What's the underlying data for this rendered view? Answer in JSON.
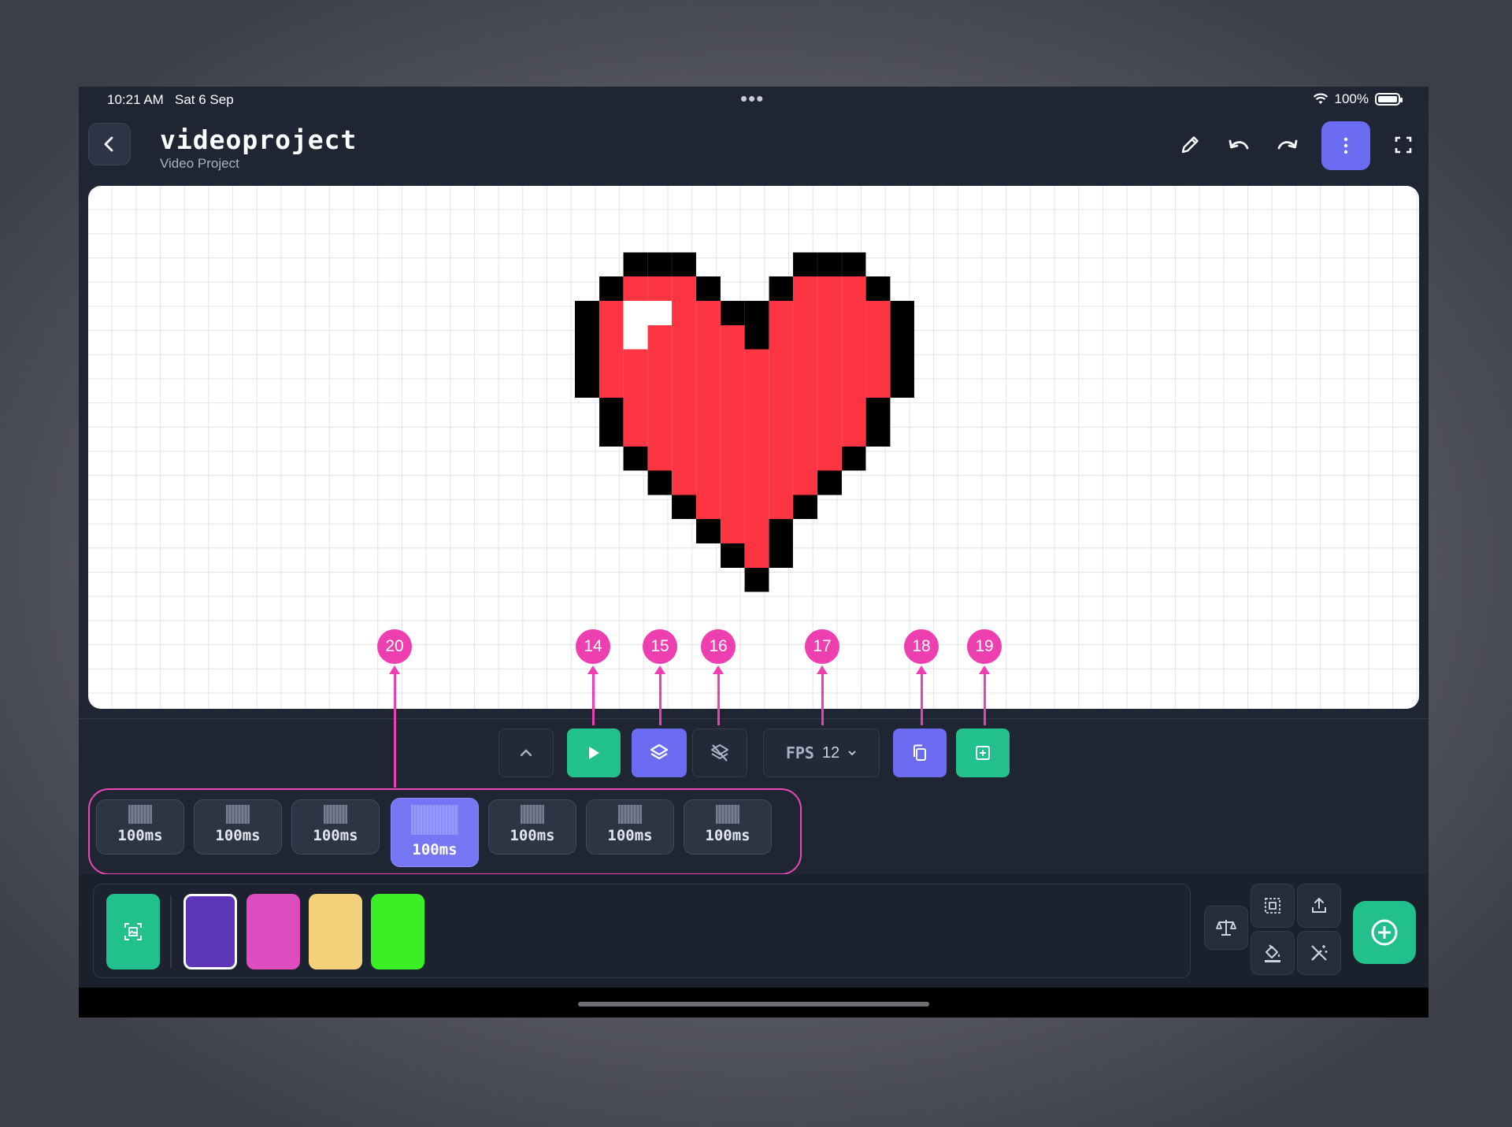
{
  "status": {
    "time": "10:21 AM",
    "date": "Sat 6 Sep",
    "battery": "100%"
  },
  "header": {
    "title": "videoproject",
    "subtitle": "Video Project"
  },
  "canvas": {
    "drawing": "pixel heart",
    "colors": {
      "fill": "#fd3442",
      "outline": "#000000",
      "highlight": "#ffffff"
    }
  },
  "toolbar": {
    "fps_label": "FPS",
    "fps_value": "12",
    "colors": {
      "green": "#21c08c",
      "purple": "#6c6cf2"
    }
  },
  "frames": [
    {
      "duration": "100ms",
      "active": false
    },
    {
      "duration": "100ms",
      "active": false
    },
    {
      "duration": "100ms",
      "active": false
    },
    {
      "duration": "100ms",
      "active": true
    },
    {
      "duration": "100ms",
      "active": false
    },
    {
      "duration": "100ms",
      "active": false
    },
    {
      "duration": "100ms",
      "active": false
    }
  ],
  "palette": {
    "swatches": [
      "#5c35b8",
      "#de4cbf",
      "#f2d17a",
      "#3bef26"
    ],
    "selected_index": 0
  },
  "callouts": {
    "c14": "14",
    "c15": "15",
    "c16": "16",
    "c17": "17",
    "c18": "18",
    "c19": "19",
    "c20": "20",
    "color": "#ee3fb1"
  }
}
